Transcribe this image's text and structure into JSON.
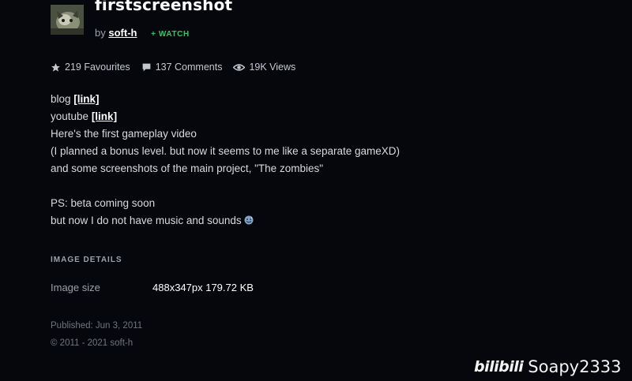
{
  "header": {
    "title": "firstscreenshot",
    "by_label": "by",
    "author": "soft-h",
    "watch_label": "+ WATCH"
  },
  "stats": {
    "favourites": "219 Favourites",
    "comments": "137 Comments",
    "views": "19K Views"
  },
  "description": {
    "line1_prefix": "blog",
    "line1_link": "[link]",
    "line2_prefix": "youtube",
    "line2_link": "[link]",
    "line3": "Here's the first gameplay video",
    "line4": "(I planned a bonus level. but now it seems to me like a separate gameXD)",
    "line5": "and some screenshots of the main project, \"The zombies\"",
    "line6": "PS: beta coming soon",
    "line7": "but now I do not have music and sounds"
  },
  "image_details": {
    "heading": "IMAGE DETAILS",
    "size_label": "Image size",
    "size_value": "488x347px 179.72 KB"
  },
  "footer": {
    "published": "Published: Jun 3, 2011",
    "copyright": "© 2011 - 2021 soft-h"
  },
  "watermark": {
    "logo_text": "bilibili",
    "user": "Soapy2333"
  },
  "colors": {
    "background": "#06070d",
    "watch_green": "#2ec866",
    "text": "#d7dadd",
    "muted": "#9ba1a8"
  }
}
